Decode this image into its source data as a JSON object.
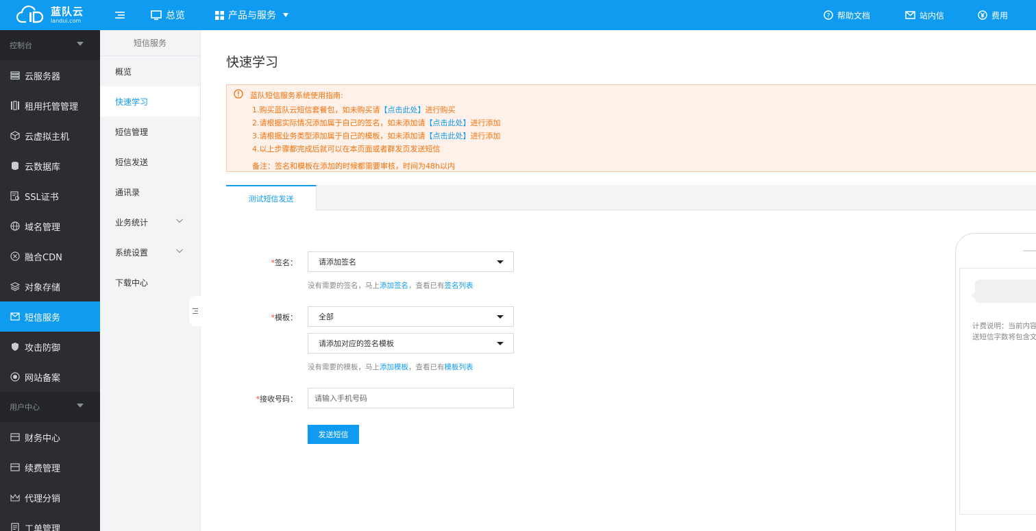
{
  "brand": {
    "name_cn": "蓝队云",
    "name_en": "landui.com",
    "color": "#0f9bf0"
  },
  "topbar": {
    "overview": "总览",
    "products": "产品与服务",
    "help_docs": "帮助文档",
    "messages": "站内信",
    "billing": "费用"
  },
  "sidebar": {
    "console_group": "控制台",
    "user_group": "用户中心",
    "items": [
      {
        "label": "云服务器",
        "icon": "server-icon"
      },
      {
        "label": "租用托管管理",
        "icon": "rack-icon"
      },
      {
        "label": "云虚拟主机",
        "icon": "cube-icon"
      },
      {
        "label": "云数据库",
        "icon": "database-icon"
      },
      {
        "label": "SSL证书",
        "icon": "certificate-icon"
      },
      {
        "label": "域名管理",
        "icon": "globe-icon"
      },
      {
        "label": "融合CDN",
        "icon": "cdn-icon"
      },
      {
        "label": "对象存储",
        "icon": "layers-icon"
      },
      {
        "label": "短信服务",
        "icon": "mail-icon",
        "active": true
      },
      {
        "label": "攻击防御",
        "icon": "shield-icon"
      },
      {
        "label": "网站备案",
        "icon": "record-icon"
      }
    ],
    "user_items": [
      {
        "label": "财务中心",
        "icon": "finance-icon"
      },
      {
        "label": "续费管理",
        "icon": "renew-icon"
      },
      {
        "label": "代理分销",
        "icon": "crown-icon"
      },
      {
        "label": "工单管理",
        "icon": "ticket-icon"
      }
    ]
  },
  "subnav": {
    "title": "短信服务",
    "items": [
      {
        "label": "概览"
      },
      {
        "label": "快速学习",
        "active": true
      },
      {
        "label": "短信管理"
      },
      {
        "label": "短信发送"
      },
      {
        "label": "通讯录"
      },
      {
        "label": "业务统计",
        "expandable": true
      },
      {
        "label": "系统设置",
        "expandable": true
      },
      {
        "label": "下载中心"
      }
    ]
  },
  "main": {
    "title": "快速学习",
    "notice": {
      "heading": "蓝队短信服务系统使用指南:",
      "step1_pre": "1.购买蓝队云短信套餐包，如未购买请",
      "step1_link": "【点击此处】",
      "step1_post": "进行购买",
      "step2_pre": "2.请根据实际情况添加属于自己的签名，如未添加请",
      "step2_link": "【点击此处】",
      "step2_post": "进行添加",
      "step3_pre": "3.请根据业务类型添加属于自己的模板，如未添加请",
      "step3_link": "【点击此处】",
      "step3_post": "进行添加",
      "step4": "4.以上步骤都完成后就可以在本页面或者群发页发送短信",
      "remark": "备注：签名和模板在添加的时候都需要审核，时间为48h以内"
    },
    "tab": "测试短信发送",
    "form": {
      "sign_label": "签名：",
      "sign_value": "请添加签名",
      "sign_hint_pre": "没有需要的签名，马上",
      "sign_hint_add": "添加签名",
      "sign_hint_mid": "，查看已有",
      "sign_hint_list": "签名列表",
      "template_label": "模板：",
      "template_category": "全部",
      "template_value": "请添加对应的签名模板",
      "template_hint_pre": "没有需要的模板，马上",
      "template_hint_add": "添加模板",
      "template_hint_mid": "，查看已有",
      "template_hint_list": "模板列表",
      "phone_label": "接收号码：",
      "phone_placeholder": "请输入手机号码",
      "required_mark": "*",
      "send_button": "发送短信"
    },
    "preview": {
      "fee_line1": "计费说明：当前内容",
      "fee_line2": "送短信字数将包含文"
    }
  }
}
